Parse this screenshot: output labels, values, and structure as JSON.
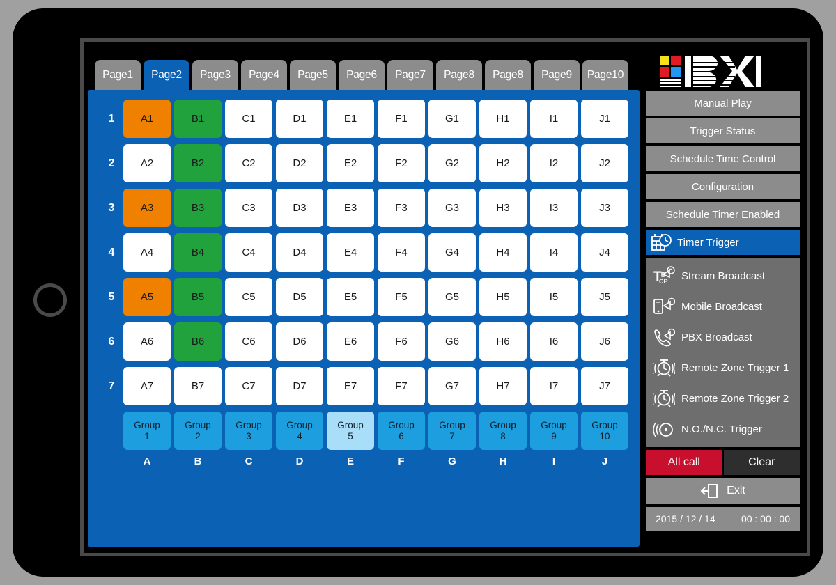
{
  "tabs": [
    {
      "label": "Page1",
      "active": false
    },
    {
      "label": "Page2",
      "active": true
    },
    {
      "label": "Page3",
      "active": false
    },
    {
      "label": "Page4",
      "active": false
    },
    {
      "label": "Page5",
      "active": false
    },
    {
      "label": "Page6",
      "active": false
    },
    {
      "label": "Page7",
      "active": false
    },
    {
      "label": "Page8",
      "active": false
    },
    {
      "label": "Page8",
      "active": false
    },
    {
      "label": "Page9",
      "active": false
    },
    {
      "label": "Page10",
      "active": false
    }
  ],
  "grid": {
    "row_numbers": [
      "1",
      "2",
      "3",
      "4",
      "5",
      "6",
      "7"
    ],
    "column_labels": [
      "A",
      "B",
      "C",
      "D",
      "E",
      "F",
      "G",
      "H",
      "I",
      "J"
    ],
    "rows": [
      [
        {
          "label": "A1",
          "state": "orange"
        },
        {
          "label": "B1",
          "state": "green"
        },
        {
          "label": "C1",
          "state": "off"
        },
        {
          "label": "D1",
          "state": "off"
        },
        {
          "label": "E1",
          "state": "off"
        },
        {
          "label": "F1",
          "state": "off"
        },
        {
          "label": "G1",
          "state": "off"
        },
        {
          "label": "H1",
          "state": "off"
        },
        {
          "label": "I1",
          "state": "off"
        },
        {
          "label": "J1",
          "state": "off"
        }
      ],
      [
        {
          "label": "A2",
          "state": "off"
        },
        {
          "label": "B2",
          "state": "green"
        },
        {
          "label": "C2",
          "state": "off"
        },
        {
          "label": "D2",
          "state": "off"
        },
        {
          "label": "E2",
          "state": "off"
        },
        {
          "label": "F2",
          "state": "off"
        },
        {
          "label": "G2",
          "state": "off"
        },
        {
          "label": "H2",
          "state": "off"
        },
        {
          "label": "I2",
          "state": "off"
        },
        {
          "label": "J2",
          "state": "off"
        }
      ],
      [
        {
          "label": "A3",
          "state": "orange"
        },
        {
          "label": "B3",
          "state": "green"
        },
        {
          "label": "C3",
          "state": "off"
        },
        {
          "label": "D3",
          "state": "off"
        },
        {
          "label": "E3",
          "state": "off"
        },
        {
          "label": "F3",
          "state": "off"
        },
        {
          "label": "G3",
          "state": "off"
        },
        {
          "label": "H3",
          "state": "off"
        },
        {
          "label": "I3",
          "state": "off"
        },
        {
          "label": "J3",
          "state": "off"
        }
      ],
      [
        {
          "label": "A4",
          "state": "off"
        },
        {
          "label": "B4",
          "state": "green"
        },
        {
          "label": "C4",
          "state": "off"
        },
        {
          "label": "D4",
          "state": "off"
        },
        {
          "label": "E4",
          "state": "off"
        },
        {
          "label": "F4",
          "state": "off"
        },
        {
          "label": "G4",
          "state": "off"
        },
        {
          "label": "H4",
          "state": "off"
        },
        {
          "label": "I4",
          "state": "off"
        },
        {
          "label": "J4",
          "state": "off"
        }
      ],
      [
        {
          "label": "A5",
          "state": "orange"
        },
        {
          "label": "B5",
          "state": "green"
        },
        {
          "label": "C5",
          "state": "off"
        },
        {
          "label": "D5",
          "state": "off"
        },
        {
          "label": "E5",
          "state": "off"
        },
        {
          "label": "F5",
          "state": "off"
        },
        {
          "label": "G5",
          "state": "off"
        },
        {
          "label": "H5",
          "state": "off"
        },
        {
          "label": "I5",
          "state": "off"
        },
        {
          "label": "J5",
          "state": "off"
        }
      ],
      [
        {
          "label": "A6",
          "state": "off"
        },
        {
          "label": "B6",
          "state": "green"
        },
        {
          "label": "C6",
          "state": "off"
        },
        {
          "label": "D6",
          "state": "off"
        },
        {
          "label": "E6",
          "state": "off"
        },
        {
          "label": "F6",
          "state": "off"
        },
        {
          "label": "G6",
          "state": "off"
        },
        {
          "label": "H6",
          "state": "off"
        },
        {
          "label": "I6",
          "state": "off"
        },
        {
          "label": "J6",
          "state": "off"
        }
      ],
      [
        {
          "label": "A7",
          "state": "off"
        },
        {
          "label": "B7",
          "state": "off"
        },
        {
          "label": "C7",
          "state": "off"
        },
        {
          "label": "D7",
          "state": "off"
        },
        {
          "label": "E7",
          "state": "off"
        },
        {
          "label": "F7",
          "state": "off"
        },
        {
          "label": "G7",
          "state": "off"
        },
        {
          "label": "H7",
          "state": "off"
        },
        {
          "label": "I7",
          "state": "off"
        },
        {
          "label": "J7",
          "state": "off"
        }
      ]
    ],
    "groups": [
      {
        "line1": "Group",
        "line2": "1",
        "selected": false
      },
      {
        "line1": "Group",
        "line2": "2",
        "selected": false
      },
      {
        "line1": "Group",
        "line2": "3",
        "selected": false
      },
      {
        "line1": "Group",
        "line2": "4",
        "selected": false
      },
      {
        "line1": "Group",
        "line2": "5",
        "selected": true
      },
      {
        "line1": "Group",
        "line2": "6",
        "selected": false
      },
      {
        "line1": "Group",
        "line2": "7",
        "selected": false
      },
      {
        "line1": "Group",
        "line2": "8",
        "selected": false
      },
      {
        "line1": "Group",
        "line2": "9",
        "selected": false
      },
      {
        "line1": "Group",
        "line2": "10",
        "selected": false
      }
    ]
  },
  "sidebar": {
    "logo_text": "BXB",
    "menu": [
      {
        "label": "Manual Play",
        "active": false,
        "icon": null
      },
      {
        "label": "Trigger Status",
        "active": false,
        "icon": null
      },
      {
        "label": "Schedule Time Control",
        "active": false,
        "icon": null
      },
      {
        "label": "Configuration",
        "active": false,
        "icon": null
      },
      {
        "label": "Schedule Timer Enabled",
        "active": false,
        "icon": null
      },
      {
        "label": "Timer Trigger",
        "active": true,
        "icon": "calendar-clock-icon"
      }
    ],
    "icon_menu": [
      {
        "label": "Stream Broadcast",
        "icon": "tcp-megaphone-icon"
      },
      {
        "label": "Mobile Broadcast",
        "icon": "mobile-megaphone-icon"
      },
      {
        "label": "PBX Broadcast",
        "icon": "phone-megaphone-icon"
      },
      {
        "label": "Remote Zone Trigger 1",
        "icon": "alarm-clock-icon"
      },
      {
        "label": "Remote Zone Trigger 2",
        "icon": "alarm-clock-icon"
      },
      {
        "label": "N.O./N.C. Trigger",
        "icon": "signal-wave-icon"
      }
    ],
    "all_call_label": "All call",
    "clear_label": "Clear",
    "exit_label": "Exit",
    "exit_icon": "exit-arrow-icon",
    "status": {
      "date": "2015 / 12 / 14",
      "time": "00 : 00 : 00"
    }
  },
  "colors": {
    "panel_blue": "#0b62b5",
    "tab_gray": "#8c8c8c",
    "cell_orange": "#f08000",
    "cell_green": "#22a23c",
    "group_blue": "#1d9ede",
    "group_selected": "#a8def8",
    "all_call_red": "#c8102e",
    "clear_dark": "#2e2e2e",
    "icon_panel_gray": "#6e6e6e",
    "background_gray": "#a0a0a0"
  }
}
